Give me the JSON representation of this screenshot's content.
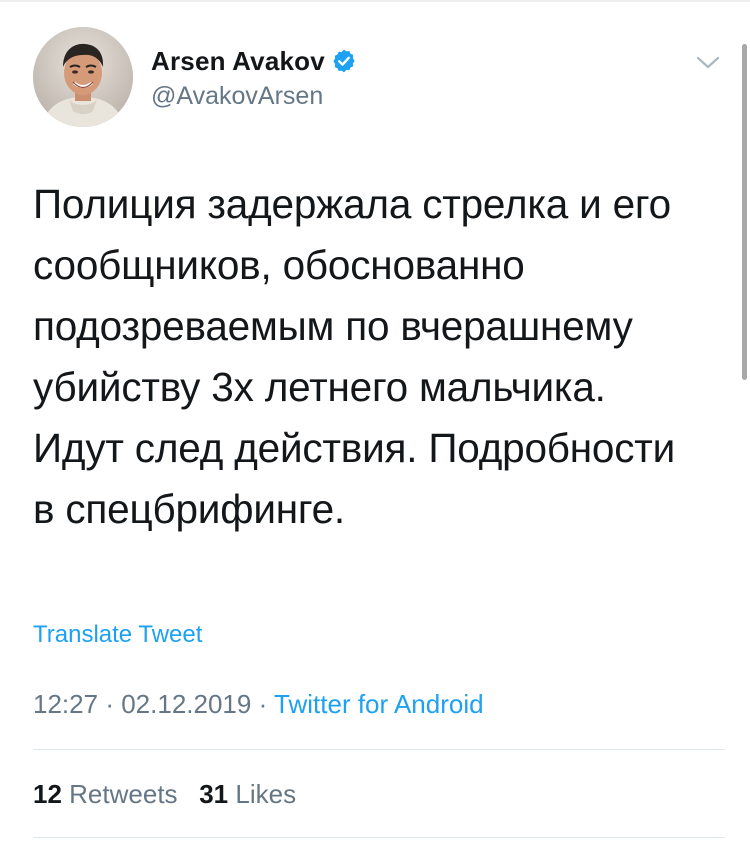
{
  "tweet": {
    "author": {
      "display_name": "Arsen Avakov",
      "handle": "@AvakovArsen",
      "verified": true,
      "verified_icon": "verified-badge-icon",
      "verified_color": "#1da1f2"
    },
    "text": "Полиция задержала стрелка и его\nсообщников, обоснованно\nподозреваемым по вчерашнему\nубийству 3х летнего мальчика.\nИдут след действия. Подробности\nв спецбрифинге.",
    "translate_label": "Translate Tweet",
    "time": "12:27",
    "date": "02.12.2019",
    "separator": "·",
    "source": "Twitter for Android",
    "retweets_count": "12",
    "retweets_label": "Retweets",
    "likes_count": "31",
    "likes_label": "Likes",
    "menu_icon": "chevron-down-icon"
  },
  "colors": {
    "accent": "#1da1f2",
    "text_primary": "#14171a",
    "text_secondary": "#657786",
    "divider": "#e1e8ed"
  }
}
